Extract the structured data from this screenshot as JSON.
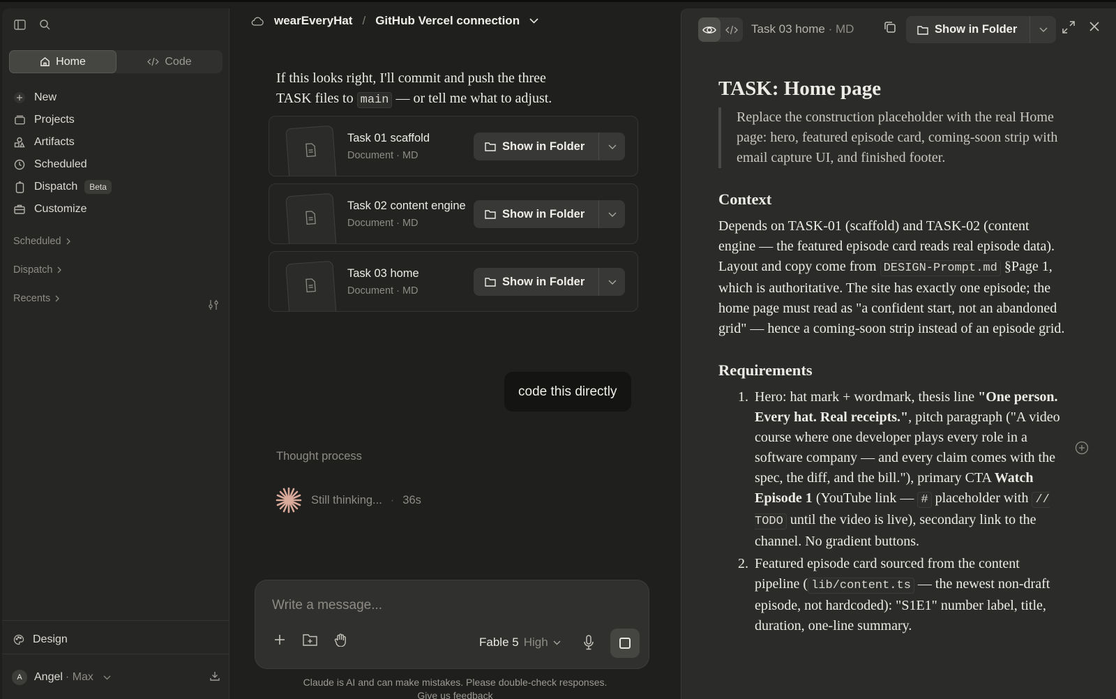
{
  "sidebar": {
    "tabs": [
      {
        "label": "Home"
      },
      {
        "label": "Code"
      }
    ],
    "items": [
      {
        "label": "New",
        "icon": "plus-icon"
      },
      {
        "label": "Projects",
        "icon": "folder-icon"
      },
      {
        "label": "Artifacts",
        "icon": "artifacts-icon"
      },
      {
        "label": "Scheduled",
        "icon": "clock-icon"
      },
      {
        "label": "Dispatch",
        "icon": "phone-icon",
        "badge": "Beta"
      },
      {
        "label": "Customize",
        "icon": "briefcase-icon"
      }
    ],
    "sections": [
      "Scheduled",
      "Dispatch",
      "Recents"
    ],
    "design_label": "Design",
    "user": {
      "initial": "A",
      "name": "Angel",
      "plan": "· Max"
    }
  },
  "chat": {
    "breadcrumb": {
      "project": "wearEveryHat",
      "conversation": "GitHub Vercel connection"
    },
    "assistant_text": {
      "line1": "If this looks right, I'll commit and push the three",
      "line2a": "TASK files to",
      "code": "main",
      "line2b": "— or tell me what to adjust."
    },
    "files": [
      {
        "title": "Task 01 scaffold",
        "sub": "Document · MD"
      },
      {
        "title": "Task 02 content engine",
        "sub": "Document · MD"
      },
      {
        "title": "Task 03 home",
        "sub": "Document · MD"
      }
    ],
    "show_in_folder": "Show in Folder",
    "user_message": "code this directly",
    "thought_label": "Thought process",
    "thinking": {
      "label": "Still thinking...",
      "sep": "·",
      "time": "36s"
    },
    "composer": {
      "placeholder": "Write a message...",
      "model": "Fable 5",
      "effort": "High"
    },
    "disclaimer": "Claude is AI and can make mistakes. Please double-check responses.",
    "feedback": "Give us feedback"
  },
  "preview": {
    "title": "Task 03 home",
    "ext": "· MD",
    "show_in_folder": "Show in Folder",
    "doc": {
      "h1": "TASK: Home page",
      "quote": "Replace the construction placeholder with the real Home page: hero, featured episode card, coming-soon strip with email capture UI, and finished footer.",
      "context_h": "Context",
      "context_a": "Depends on TASK-01 (scaffold) and TASK-02 (content engine — the featured episode card reads real episode data). Layout and copy come from",
      "context_code": "DESIGN-Prompt.md",
      "context_b": "§Page 1, which is authoritative. The site has exactly one episode; the home page must read as \"a confident start, not an abandoned grid\" — hence a coming-soon strip instead of an episode grid.",
      "req_h": "Requirements",
      "req1": {
        "a": "Hero: hat mark + wordmark, thesis line",
        "b": "\"One person. Every hat. Real receipts.\"",
        "c": ", pitch paragraph (\"A video course where one developer plays every role in a software company — and every claim comes with the spec, the diff, and the bill.\"), primary CTA",
        "d": "Watch Episode 1",
        "e": "(YouTube link —",
        "code1": "#",
        "f": "placeholder with",
        "code2": "// TODO",
        "g": "until the video is live), secondary link to the channel. No gradient buttons."
      },
      "req2": {
        "a": "Featured episode card sourced from the content pipeline (",
        "code": "lib/content.ts",
        "b": "— the newest non-draft episode, not hardcoded): \"S1E1\" number label, title, duration, one-line summary."
      }
    }
  }
}
